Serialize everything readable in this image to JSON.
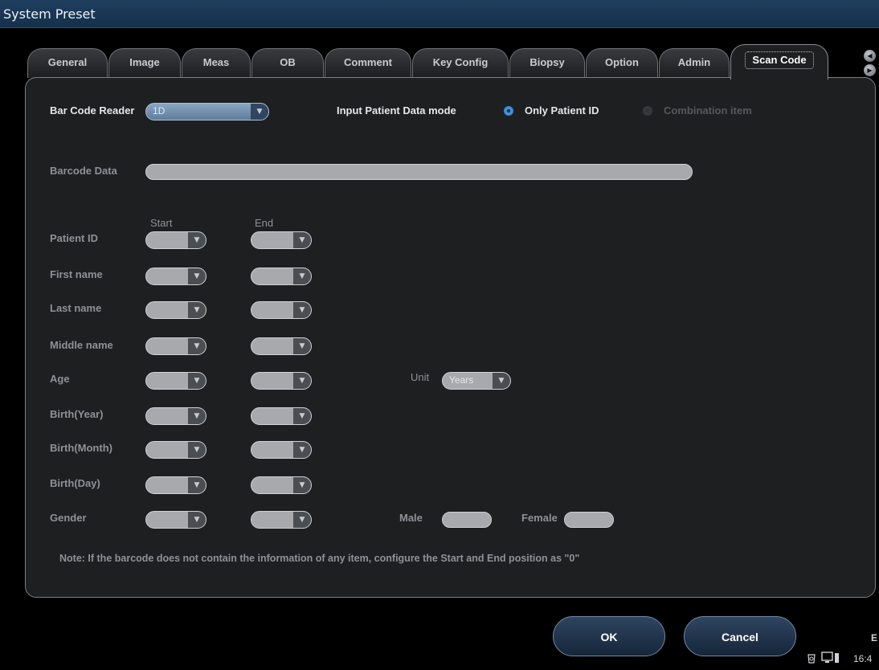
{
  "window": {
    "title": "System Preset"
  },
  "tabs": [
    {
      "label": "General"
    },
    {
      "label": "Image"
    },
    {
      "label": "Meas"
    },
    {
      "label": "OB"
    },
    {
      "label": "Comment"
    },
    {
      "label": "Key Config"
    },
    {
      "label": "Biopsy"
    },
    {
      "label": "Option"
    },
    {
      "label": "Admin"
    },
    {
      "label": "Scan Code",
      "active": true
    }
  ],
  "scan_code": {
    "bar_code_reader_label": "Bar Code Reader",
    "bar_code_reader_value": "1D",
    "input_mode_label": "Input Patient Data mode",
    "option_only_patient_id": "Only Patient ID",
    "option_combination": "Combination item",
    "selected_mode": "Only Patient ID",
    "barcode_data_label": "Barcode Data",
    "barcode_data_value": "",
    "col_start": "Start",
    "col_end": "End",
    "fields": [
      {
        "label": "Patient ID"
      },
      {
        "label": "First name"
      },
      {
        "label": "Last name"
      },
      {
        "label": "Middle name"
      },
      {
        "label": "Age"
      },
      {
        "label": "Birth(Year)"
      },
      {
        "label": "Birth(Month)"
      },
      {
        "label": "Birth(Day)"
      },
      {
        "label": "Gender"
      }
    ],
    "unit_label": "Unit",
    "unit_value": "Years",
    "male_label": "Male",
    "female_label": "Female",
    "note": "Note: If the barcode does not contain the information of any item, configure the Start and End position as \"0\""
  },
  "buttons": {
    "ok": "OK",
    "cancel": "Cancel"
  },
  "status": {
    "time": "16:4",
    "indicator": "E"
  },
  "colors": {
    "title_bar": "#14304b",
    "panel": "#1e1f21",
    "accent": "#4a9ee8"
  }
}
